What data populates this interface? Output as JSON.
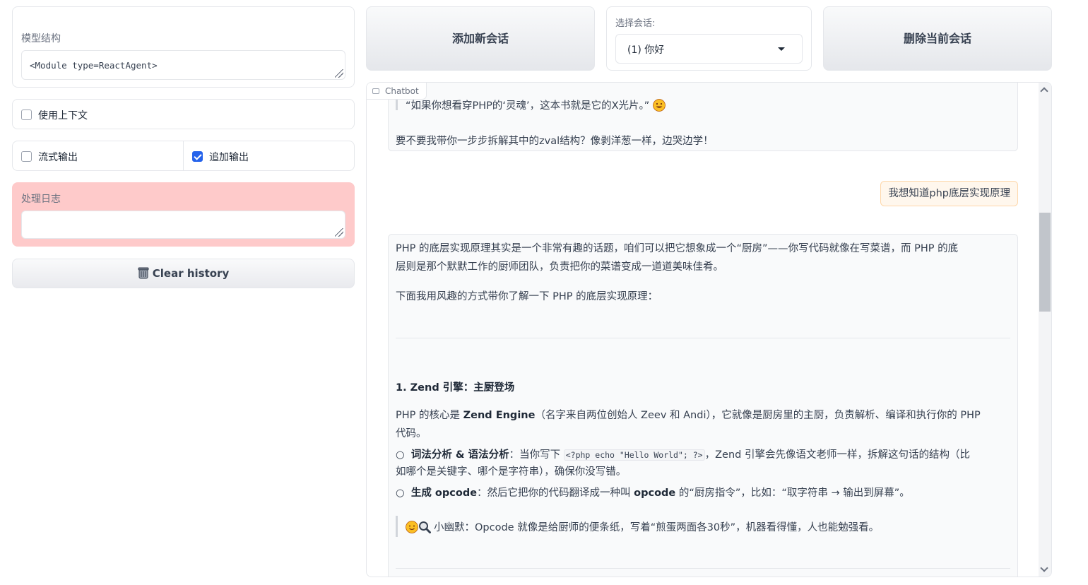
{
  "left": {
    "model_label": "模型结构",
    "model_value": "<Module type=ReactAgent>",
    "context_label": "使用上下文",
    "stream_label": "流式输出",
    "append_label": "追加输出",
    "context_checked": false,
    "stream_checked": false,
    "append_checked": true,
    "log_label": "处理日志",
    "log_value": "",
    "clear_label": "Clear history"
  },
  "top": {
    "add_label": "添加新会话",
    "session_label": "选择会话:",
    "session_value": "(1) 你好",
    "delete_label": "删除当前会话"
  },
  "chat": {
    "tag": "Chatbot",
    "m1_quote": "“如果你想看穿PHP的‘灵魂’，这本书就是它的X光片。”",
    "m1_text": "要不要我带你一步步拆解其中的zval结构？像剥洋葱一样，边哭边学！",
    "user_msg": "我想知道php底层实现原理",
    "m3": {
      "p1a": "PHP 的底层实现原理其实是一个非常有趣的话题，咱们可以把它想象成一个“厨房”——你写代码就像在写菜谱，而 PHP 的底",
      "p1b": "层则是那个默默工作的厨师团队，负责把你的菜谱变成一道道美味佳肴。",
      "p2": "下面我用风趣的方式带你了解一下 PHP 的底层实现原理：",
      "h1": "1. Zend 引擎：主厨登场",
      "p3a_pre": "PHP 的核心是 ",
      "p3a_bold": "Zend Engine",
      "p3a_post": "（名字来自两位创始人 Zeev 和 Andi），它就像是厨房里的主厨，负责解析、编译和执行你的 PHP",
      "p3b": "代码。",
      "b1_bold": "词法分析 & 语法分析",
      "b1_pre": "：当你写下 ",
      "b1_code": "<?php echo \"Hello World\"; ?>",
      "b1_post": "，Zend 引擎会先像语文老师一样，拆解这句话的结构（比",
      "b1_line2": "如哪个是关键字、哪个是字符串），确保你没写错。",
      "b2_bold": "生成 opcode",
      "b2_pre": "：然后它把你的代码翻译成一种叫 ",
      "b2_bold2": "opcode",
      "b2_post": " 的“厨房指令”，比如：“取字符串 → 输出到屏幕”。",
      "quote": "小幽默：Opcode 就像是给厨师的便条纸，写着“煎蛋两面各30秒”，机器看得懂，人也能勉强看。",
      "bullet": "○"
    }
  }
}
